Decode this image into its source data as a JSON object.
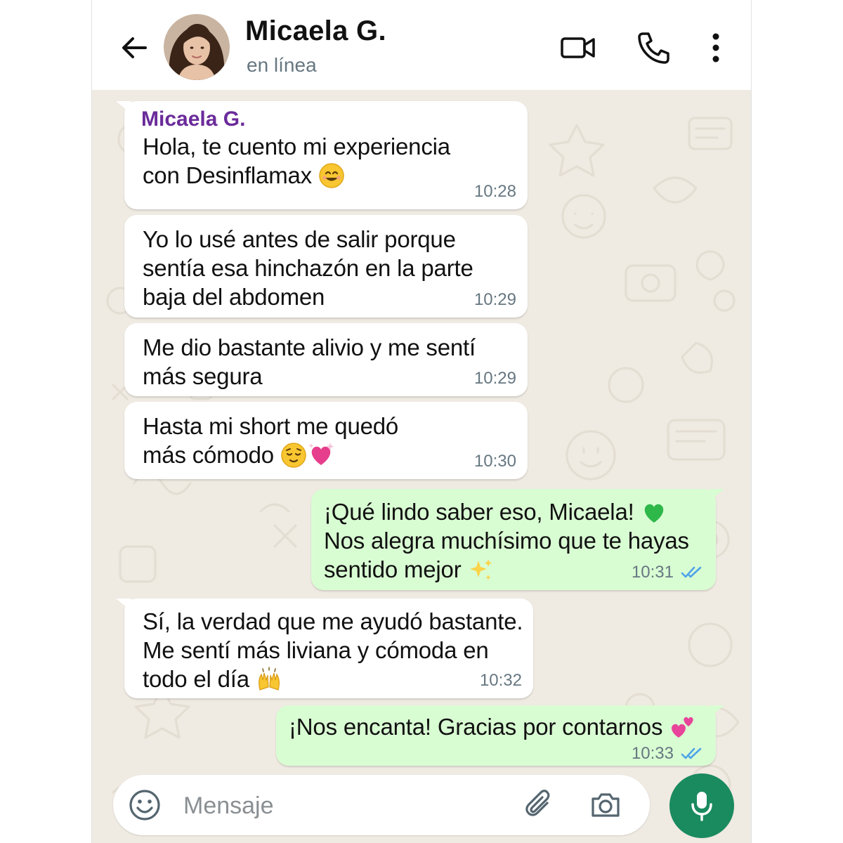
{
  "header": {
    "contact_name": "Micaela G.",
    "status": "en línea",
    "icons": [
      "back-arrow-icon",
      "video-call-icon",
      "phone-icon",
      "more-options-icon"
    ]
  },
  "colors": {
    "incoming_bubble": "#ffffff",
    "outgoing_bubble": "#d9fdd3",
    "chat_background": "#efeae2",
    "sender_name": "#6a2b9a",
    "read_ticks": "#4fa3e8",
    "mic_button": "#1a8a5f"
  },
  "messages": [
    {
      "direction": "in",
      "sender": "Micaela G.",
      "lines": [
        "Hola, te cuento mi experiencia",
        "con Desinflamax"
      ],
      "emoji": "smiling-face",
      "time": "10:28"
    },
    {
      "direction": "in",
      "lines": [
        "Yo lo usé antes de salir porque",
        "sentía esa hinchazón en la parte",
        "baja del abdomen"
      ],
      "time": "10:29"
    },
    {
      "direction": "in",
      "lines": [
        "Me dio bastante alivio y me sentí",
        "más segura"
      ],
      "time": "10:29"
    },
    {
      "direction": "in",
      "lines": [
        "Hasta mi short me quedó",
        "más cómodo"
      ],
      "emoji": "relieved-face sparkling-heart",
      "time": "10:30"
    },
    {
      "direction": "out",
      "lines": [
        "¡Qué lindo saber eso, Micaela!",
        "Nos alegra muchísimo que te hayas",
        "sentido mejor"
      ],
      "emoji": "green-heart sparkles",
      "time": "10:31",
      "status": "read"
    },
    {
      "direction": "in",
      "lines": [
        "Sí, la verdad que me ayudó bastante.",
        "Me sentí más liviana y cómoda en",
        "todo el día"
      ],
      "emoji": "raising-hands",
      "time": "10:32"
    },
    {
      "direction": "out",
      "lines": [
        "¡Nos encanta! Gracias por contarnos"
      ],
      "emoji": "two-hearts",
      "time": "10:33",
      "status": "read"
    }
  ],
  "input": {
    "placeholder": "Mensaje",
    "icons": [
      "emoji-icon",
      "attach-icon",
      "camera-icon",
      "mic-icon"
    ]
  }
}
